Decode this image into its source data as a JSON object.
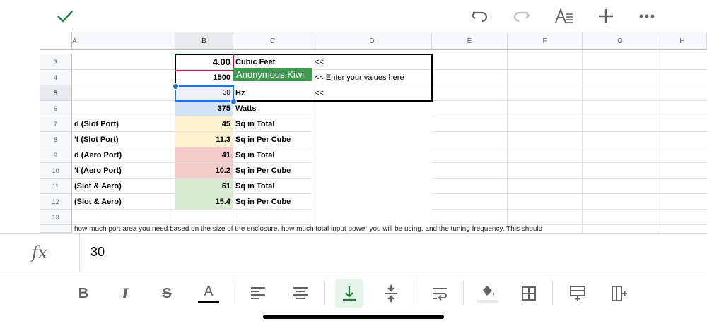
{
  "topbar": {
    "icons": [
      "checkmark-icon",
      "undo-icon",
      "redo-icon",
      "text-format-icon",
      "add-icon",
      "more-icon"
    ],
    "accent": "#188038"
  },
  "columns": [
    "A",
    "B",
    "C",
    "D",
    "E",
    "F",
    "G",
    "H"
  ],
  "rows": [
    {
      "num": "3",
      "a": "",
      "b": "4.00",
      "c": "Cubic Feet",
      "d": "<<"
    },
    {
      "num": "4",
      "a": "",
      "b": "1500",
      "c": "",
      "d": "<< Enter your values here"
    },
    {
      "num": "5",
      "a": "",
      "b": "30",
      "c": "Hz",
      "d": "<<"
    },
    {
      "num": "6",
      "a": "",
      "b": "375",
      "c": "Watts",
      "d": ""
    },
    {
      "num": "7",
      "a": "d (Slot Port)",
      "b": "45",
      "c": "Sq in Total",
      "d": ""
    },
    {
      "num": "8",
      "a": "'t (Slot Port)",
      "b": "11.3",
      "c": "Sq in Per Cube",
      "d": ""
    },
    {
      "num": "9",
      "a": "d (Aero Port)",
      "b": "41",
      "c": "Sq in Total",
      "d": ""
    },
    {
      "num": "10",
      "a": "'t (Aero Port)",
      "b": "10.2",
      "c": "Sq in Per Cube",
      "d": ""
    },
    {
      "num": "11",
      "a": "(Slot & Aero)",
      "b": "61",
      "c": "Sq in Total",
      "d": ""
    },
    {
      "num": "12",
      "a": "(Slot & Aero)",
      "b": "15.4",
      "c": "Sq in Per Cube",
      "d": ""
    },
    {
      "num": "13",
      "a": "",
      "b": "",
      "c": "",
      "d": ""
    }
  ],
  "row14_text": "how much port area you need based on the size of the enclosure, how much total input power you will be using, and the tuning frequency. This should",
  "collaborator": {
    "name": "Anonymous Kiwi",
    "color": "#3f9a52"
  },
  "fill_colors": {
    "row6": "#d3e3f6",
    "rows7_8": "#fdf2d0",
    "rows9_10": "#f4cccc",
    "rows11_12": "#d9ead3"
  },
  "formula_bar": {
    "label": "fx",
    "value": "30"
  },
  "toolbar": {
    "icons": [
      "bold-icon",
      "italic-icon",
      "strikethrough-icon",
      "text-color-icon",
      "align-left-icon",
      "align-center-icon",
      "valign-bottom-icon",
      "valign-middle-icon",
      "wrap-text-icon",
      "fill-color-icon",
      "borders-icon",
      "insert-row-icon",
      "insert-column-icon"
    ],
    "active_tool": "valign-bottom-icon",
    "labels": {
      "bold": "B",
      "italic": "I",
      "strike": "S",
      "text_color": "A"
    }
  }
}
